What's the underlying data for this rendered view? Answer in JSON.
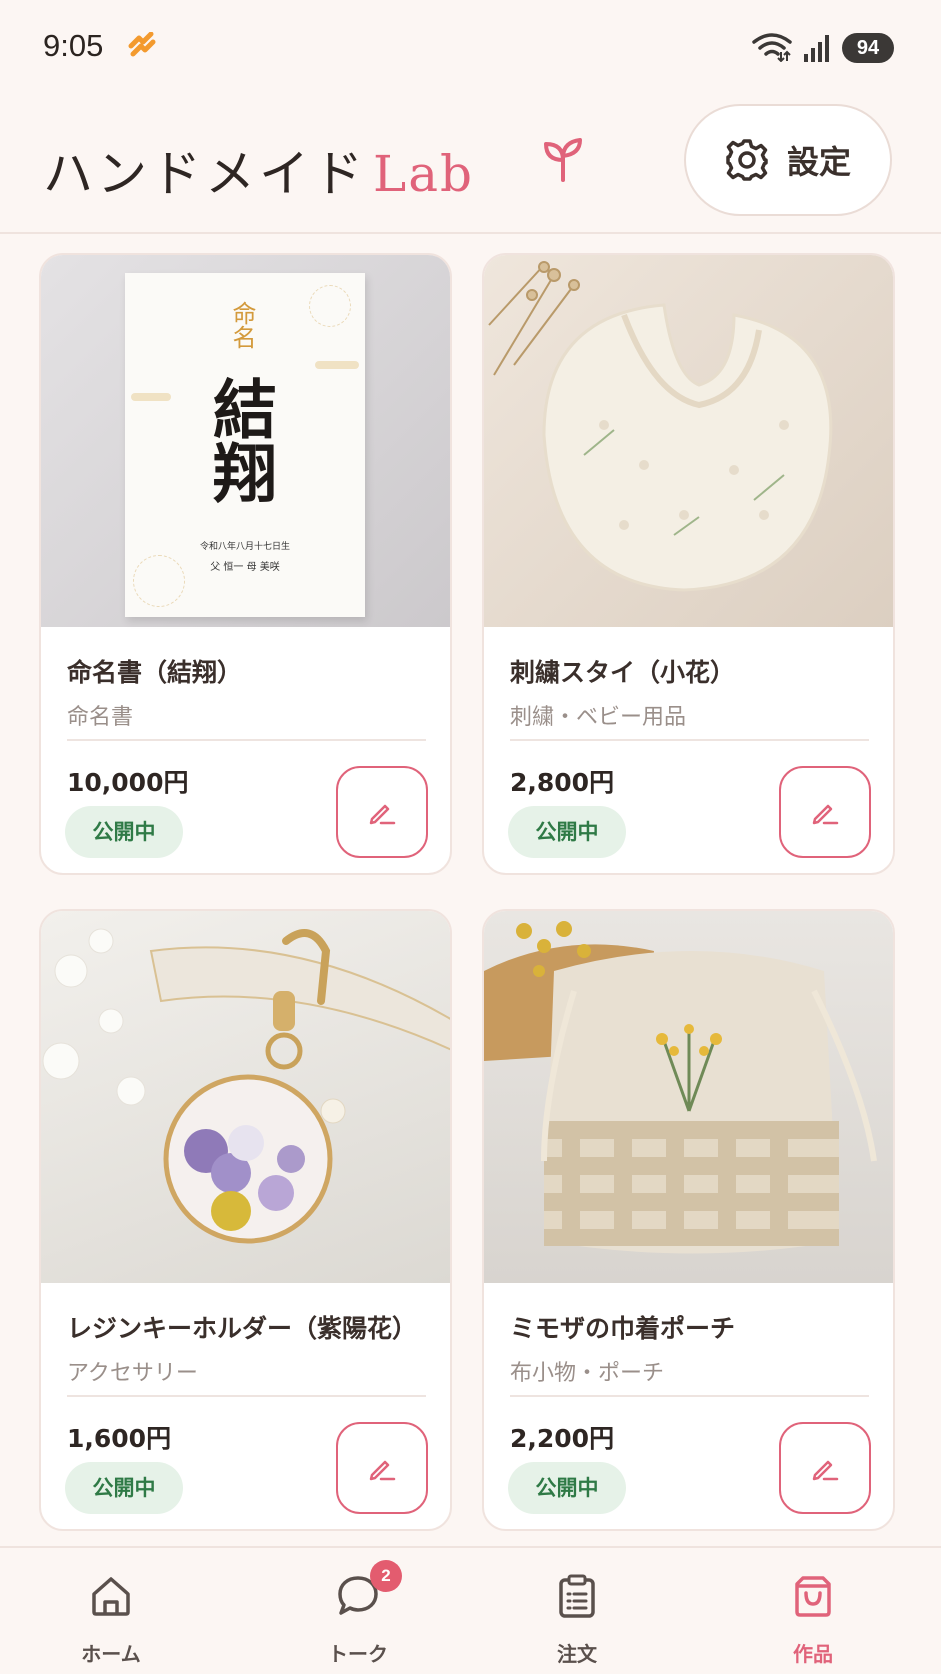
{
  "status_bar": {
    "time": "9:05",
    "battery": "94"
  },
  "header": {
    "title": "ハンドメイド",
    "title_accent": "Lab",
    "settings_label": "設定"
  },
  "products": [
    {
      "name": "命名書（結翔）",
      "category": "命名書",
      "price": "10,000円",
      "status": "公開中"
    },
    {
      "name": "刺繍スタイ（小花）",
      "category": "刺繍・ベビー用品",
      "price": "2,800円",
      "status": "公開中"
    },
    {
      "name": "レジンキーホルダー（紫陽花）",
      "category": "アクセサリー",
      "price": "1,600円",
      "status": "公開中"
    },
    {
      "name": "ミモザの巾着ポーチ",
      "category": "布小物・ポーチ",
      "price": "2,200円",
      "status": "公開中"
    }
  ],
  "thumbnails": {
    "naming": {
      "label_top": "命名",
      "name": "結翔",
      "date": "令和八年八月十七日生",
      "parents": "父 恒一 母 美咲"
    }
  },
  "bottom_nav": {
    "items": [
      {
        "label": "ホーム",
        "icon": "home-icon"
      },
      {
        "label": "トーク",
        "icon": "chat-icon",
        "badge": "2"
      },
      {
        "label": "注文",
        "icon": "clipboard-icon"
      },
      {
        "label": "作品",
        "icon": "shopping-bag-icon",
        "active": true
      }
    ]
  },
  "colors": {
    "accent": "#e0637a",
    "status_green": "#2f7a46",
    "status_bg": "#e6f2e8",
    "background": "#fcf6f3"
  }
}
